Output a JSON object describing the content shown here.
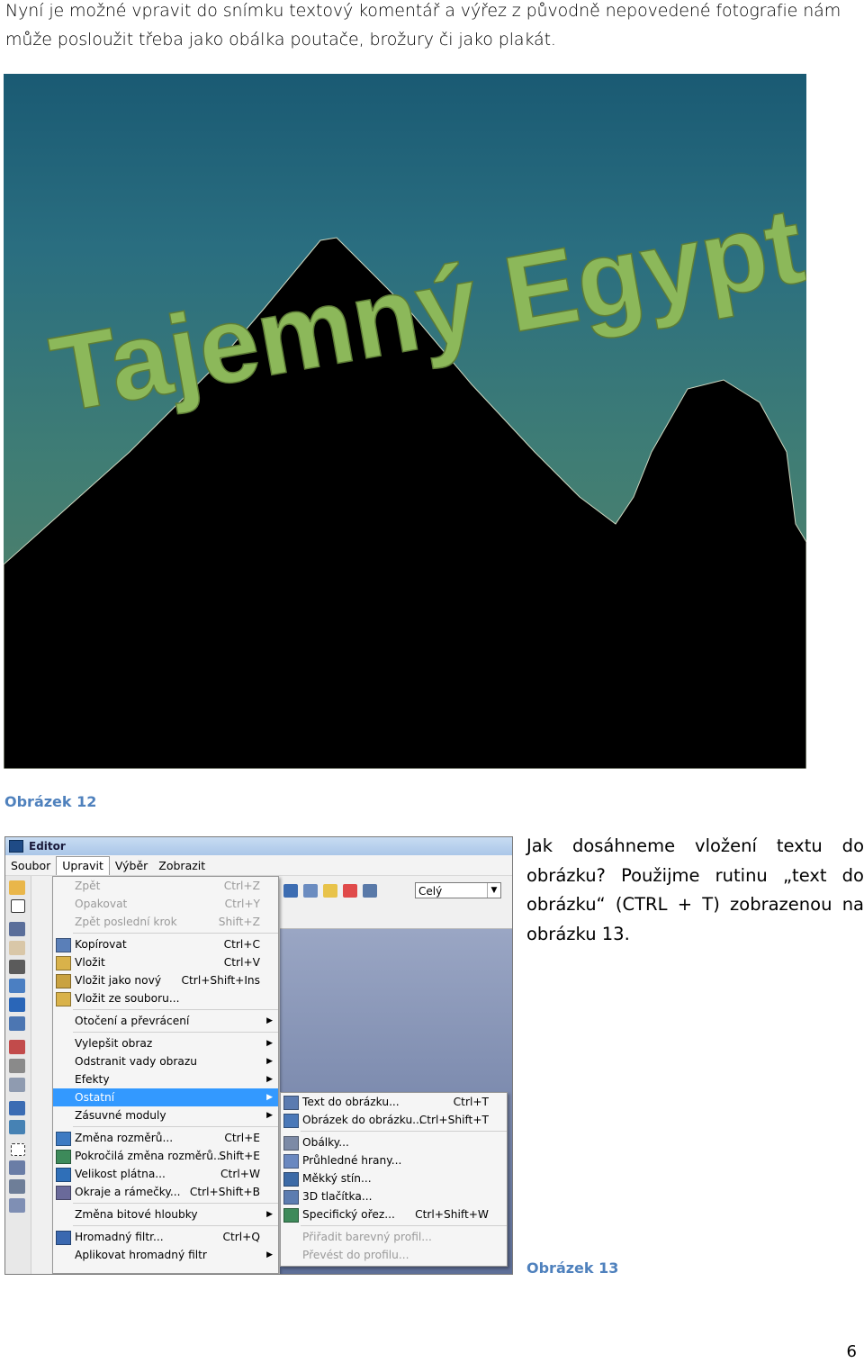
{
  "intro_text": "Nyní je možné vpravit do snímku textový komentář a výřez z původně nepovedené fotografie nám může posloužit třeba jako obálka poutače, brožury či jako plakát.",
  "photo": {
    "overlay_text": "Tajemný Egypt",
    "text_color": "#8cb85a"
  },
  "caption_12": "Obrázek 12",
  "caption_13": "Obrázek 13",
  "paragraph": "Jak dosáhneme vložení textu do obrázku? Použijme rutinu „text do obrázku“ (CTRL + T) zobrazenou na obrázku 13.",
  "page_number": "6",
  "editor": {
    "title": "Editor",
    "menubar": [
      "Soubor",
      "Upravit",
      "Výběr",
      "Zobrazit"
    ],
    "zoom_value": "Celý",
    "upravit_menu": [
      {
        "label": "Zpět",
        "shortcut": "Ctrl+Z",
        "disabled": true
      },
      {
        "label": "Opakovat",
        "shortcut": "Ctrl+Y",
        "disabled": true
      },
      {
        "label": "Zpět poslední krok",
        "shortcut": "Shift+Z",
        "disabled": true
      },
      {
        "label": "Kopírovat",
        "shortcut": "Ctrl+C"
      },
      {
        "label": "Vložit",
        "shortcut": "Ctrl+V"
      },
      {
        "label": "Vložit jako nový",
        "shortcut": "Ctrl+Shift+Ins"
      },
      {
        "label": "Vložit ze souboru...",
        "shortcut": ""
      },
      {
        "label": "Otočení a převrácení",
        "shortcut": "",
        "submenu": true
      },
      {
        "label": "Vylepšit obraz",
        "shortcut": "",
        "submenu": true
      },
      {
        "label": "Odstranit vady obrazu",
        "shortcut": "",
        "submenu": true
      },
      {
        "label": "Efekty",
        "shortcut": "",
        "submenu": true
      },
      {
        "label": "Ostatní",
        "shortcut": "",
        "submenu": true,
        "highlighted": true
      },
      {
        "label": "Zásuvné moduly",
        "shortcut": "",
        "submenu": true
      },
      {
        "label": "Změna rozměrů...",
        "shortcut": "Ctrl+E"
      },
      {
        "label": "Pokročilá změna rozměrů...",
        "shortcut": "Shift+E"
      },
      {
        "label": "Velikost plátna...",
        "shortcut": "Ctrl+W"
      },
      {
        "label": "Okraje a rámečky...",
        "shortcut": "Ctrl+Shift+B"
      },
      {
        "label": "Změna bitové hloubky",
        "shortcut": "",
        "submenu": true
      },
      {
        "label": "Hromadný filtr...",
        "shortcut": "Ctrl+Q"
      },
      {
        "label": "Aplikovat hromadný filtr",
        "shortcut": "",
        "submenu": true
      }
    ],
    "ostatni_submenu": [
      {
        "label": "Text do obrázku...",
        "shortcut": "Ctrl+T"
      },
      {
        "label": "Obrázek do obrázku...",
        "shortcut": "Ctrl+Shift+T"
      },
      {
        "label": "Obálky...",
        "shortcut": ""
      },
      {
        "label": "Průhledné hrany...",
        "shortcut": ""
      },
      {
        "label": "Měkký stín...",
        "shortcut": ""
      },
      {
        "label": "3D tlačítka...",
        "shortcut": ""
      },
      {
        "label": "Specifický ořez...",
        "shortcut": "Ctrl+Shift+W"
      },
      {
        "label": "Přiřadit barevný profil...",
        "shortcut": "",
        "disabled": true
      },
      {
        "label": "Převést do profilu...",
        "shortcut": "",
        "disabled": true
      }
    ]
  }
}
